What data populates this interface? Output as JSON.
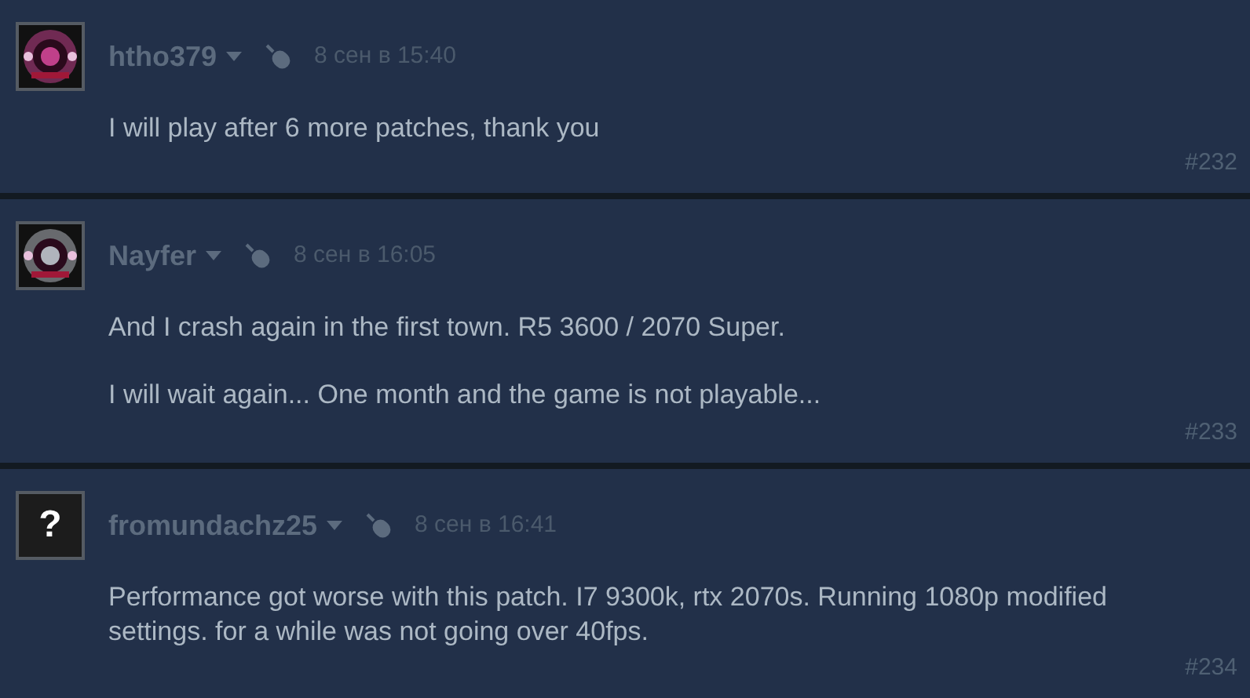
{
  "comments": [
    {
      "avatar": {
        "kind": "picture"
      },
      "author": "htho379",
      "timestamp": "8 сен в 15:40",
      "paragraphs": [
        "I will play after 6 more patches, thank you"
      ],
      "number": "#232"
    },
    {
      "avatar": {
        "kind": "picture"
      },
      "author": "Nayfer",
      "timestamp": "8 сен в 16:05",
      "paragraphs": [
        "And I crash again in the first town. R5 3600 / 2070 Super.",
        "I will wait again... One month and the game is not playable..."
      ],
      "number": "#233"
    },
    {
      "avatar": {
        "kind": "placeholder",
        "glyph": "?"
      },
      "author": "fromundachz25",
      "timestamp": "8 сен в 16:41",
      "paragraphs": [
        "Performance got worse with this patch. I7 9300k, rtx 2070s. Running 1080p modified settings. for a while was not going over 40fps."
      ],
      "number": "#234"
    }
  ]
}
